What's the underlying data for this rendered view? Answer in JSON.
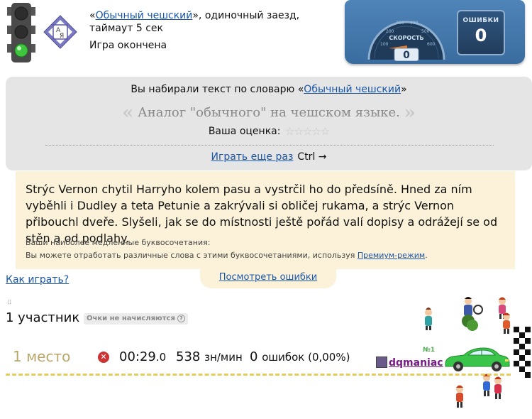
{
  "game": {
    "quote_open": "«",
    "dictionary_link": "Обычный чешский",
    "quote_close_suffix": "», одиночный заезд,",
    "timeout": "таймаут 5 сек",
    "status": "Игра окончена"
  },
  "dashboard": {
    "speed_label": "СКОРОСТЬ",
    "speed_value": "0",
    "dial_ticks": [
      "100",
      "200",
      "300",
      "400",
      "500",
      "600"
    ],
    "errors_label": "ОШИБКИ",
    "errors_value": "0"
  },
  "result_panel": {
    "title_prefix": "Вы набирали текст по словарю «",
    "title_link": "Обычный чешский",
    "title_suffix": "»",
    "quote_left": "«",
    "description": "Аналог \"обычного\" на чешском языке.",
    "quote_right": "»",
    "rating_label": "Ваша оценка:",
    "rating_stars": 5,
    "rating_value": 0,
    "play_again": "Играть еще раз",
    "shortcut": "Ctrl →"
  },
  "typed_text": {
    "text": "Strýc Vernon chytil Harryho kolem pasu a vystrčil ho do předsíně. Hned za ním vyběhli i Dudley a teta Petunie a zakrývali si obličej rukama, a strýc Vernon přibouchl dveře. Slyšeli, jak se do místnosti ještě pořád valí dopisy a odrážejí se od stěn a od podlahy.",
    "slow_combos_label": "Ваши наиболее медленные буквосочетания:",
    "slow_combos_hint": "Вы можете отработать различные слова с этими буквосочетаниями, используя ",
    "premium_link": "Премиум-режим",
    "hint_end": "."
  },
  "links": {
    "view_errors": "Посмотреть ошибки",
    "how_to_play": "Как играть?"
  },
  "participants": {
    "count_label": "1 участник",
    "points_badge": "Очки не начисляются",
    "help": "?"
  },
  "result_row": {
    "place": "1 место",
    "time_main": "00:29",
    "time_frac": ".0",
    "speed": "538",
    "speed_unit": "зн/мин",
    "errors": "0",
    "errors_text": "ошибок (0,00%)",
    "rank_tag": "№1",
    "player": "dqmaniac"
  },
  "colors": {
    "panel_bg": "#e5e5e5",
    "text_panel_bg": "#fbf2d9",
    "link": "#1a56a8",
    "place": "#b8a66a",
    "player": "#7a1a8a",
    "car": "#3ac44a",
    "dashed_track": "#e3cd5c"
  }
}
